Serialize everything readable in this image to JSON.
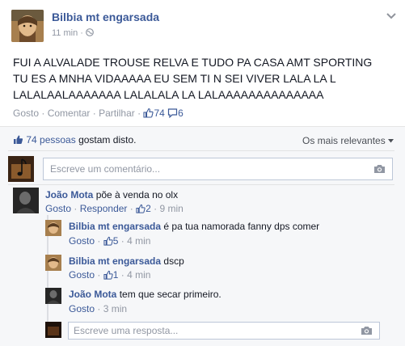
{
  "post": {
    "author": "Bilbia mt engarsada",
    "time": "11 min",
    "text_lines": [
      "FUI A ALVALADE TROUSE RELVA E TUDO PA CASA AMT SPORTING",
      "TU ES A MNHA VIDAAAAA EU SEM TI N SEI VIVER LALA LA L",
      "LALALAALAAAAAAA LALALALA LA LALAAAAAAAAAAAAAA"
    ],
    "actions": {
      "like": "Gosto",
      "comment": "Comentar",
      "share": "Partilhar",
      "like_count": "74",
      "comment_count": "6"
    }
  },
  "likes_summary": {
    "count_text": "74 pessoas",
    "suffix": "gostam disto.",
    "sort_label": "Os mais relevantes"
  },
  "comment_input": {
    "placeholder": "Escreve um comentário..."
  },
  "comments": [
    {
      "author": "João Mota",
      "text": "põe à venda no olx",
      "like": "Gosto",
      "reply": "Responder",
      "likes": "2",
      "time": "9 min"
    }
  ],
  "replies": [
    {
      "author": "Bilbia mt engarsada",
      "text": "é pa tua namorada fanny dps comer",
      "like": "Gosto",
      "likes": "5",
      "time": "4 min"
    },
    {
      "author": "Bilbia mt engarsada",
      "text": "dscp",
      "like": "Gosto",
      "likes": "1",
      "time": "4 min"
    },
    {
      "author": "João Mota",
      "text": "tem que secar primeiro.",
      "like": "Gosto",
      "time": "3 min"
    }
  ],
  "reply_input": {
    "placeholder": "Escreve uma resposta..."
  },
  "separator": "·",
  "colors": {
    "link": "#3b5998",
    "meta": "#9197a3",
    "ufi_bg": "#f6f7f9"
  }
}
